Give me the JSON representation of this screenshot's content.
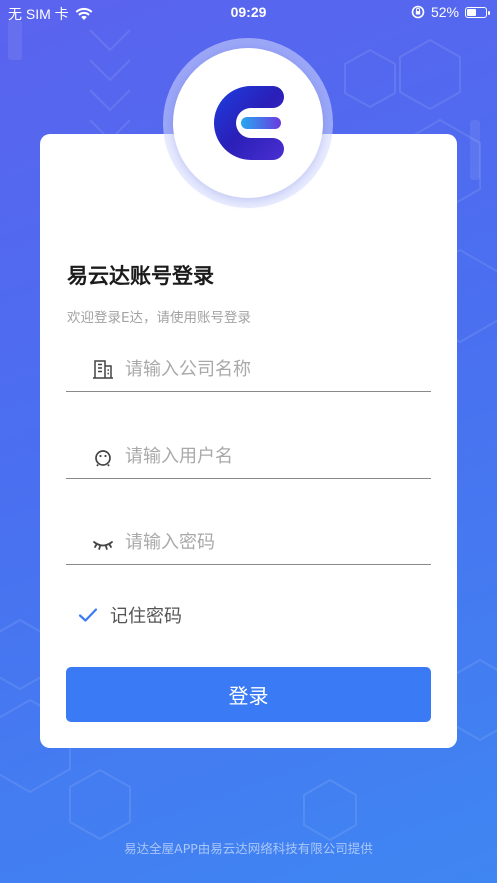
{
  "status_bar": {
    "carrier": "无 SIM 卡",
    "time": "09:29",
    "battery_percent": "52%",
    "battery_level": 0.52
  },
  "icons": {
    "wifi": "wifi-icon",
    "orientation_lock": "orientation-lock-icon",
    "battery": "battery-icon",
    "logo": "app-logo",
    "company": "building-icon",
    "user": "user-face-icon",
    "password": "closed-eye-icon",
    "remember": "checkmark-icon"
  },
  "login": {
    "title": "易云达账号登录",
    "subtitle": "欢迎登录E达，请使用账号登录",
    "company_placeholder": "请输入公司名称",
    "username_placeholder": "请输入用户名",
    "password_placeholder": "请输入密码",
    "remember_label": "记住密码",
    "submit_label": "登录"
  },
  "footer": {
    "text": "易达全屋APP由易云达网络科技有限公司提供"
  },
  "colors": {
    "background_start": "#5b63ee",
    "background_end": "#3f86f2",
    "primary_button": "#3a7bf5",
    "check_color": "#3a7bf5"
  }
}
